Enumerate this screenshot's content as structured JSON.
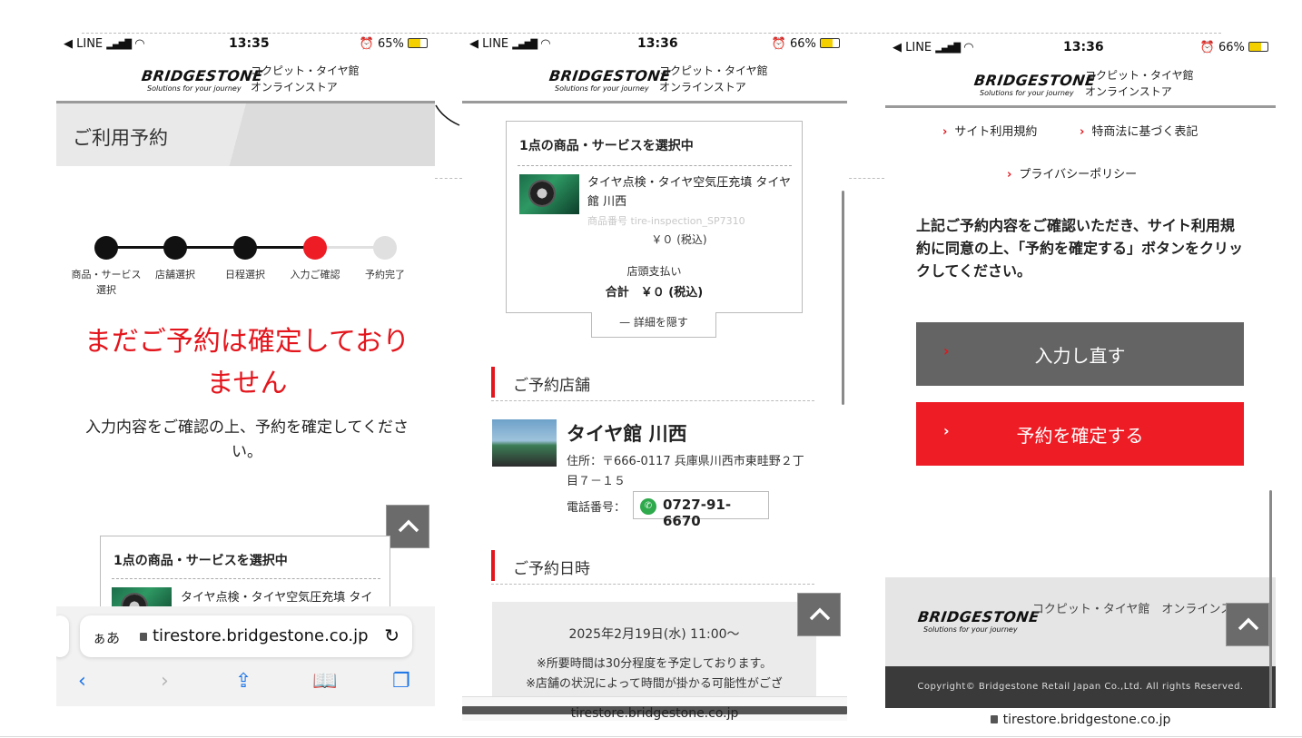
{
  "status_bars": [
    {
      "carrier": "◀ LINE",
      "time": "13:35",
      "battery": "65%"
    },
    {
      "carrier": "◀ LINE",
      "time": "13:36",
      "battery": "66%"
    },
    {
      "carrier": "◀ LINE",
      "time": "13:36",
      "battery": "66%"
    }
  ],
  "header": {
    "brand": "BRIDGESTONE",
    "tagline": "Solutions for your journey",
    "store_line1": "コクピット・タイヤ館",
    "store_line2": "オンラインストア"
  },
  "screen1": {
    "page_title": "ご利用予約",
    "steps": [
      {
        "label": "商品・サービス選択",
        "state": "done"
      },
      {
        "label": "店舗選択",
        "state": "done"
      },
      {
        "label": "日程選択",
        "state": "done"
      },
      {
        "label": "入力ご確認",
        "state": "current"
      },
      {
        "label": "予約完了",
        "state": "todo"
      }
    ],
    "warning": "まだご予約は確定しておりません",
    "instruction": "入力内容をご確認の上、予約を確定してください。",
    "cart_title": "1点の商品・サービスを選択中",
    "cart_item_preview": "タイヤ点検・タイヤ空気圧充填 タイ",
    "address_bar": {
      "aa": "ぁあ",
      "url": "tirestore.bridgestone.co.jp"
    }
  },
  "screen2": {
    "cart_title": "1点の商品・サービスを選択中",
    "product_name": "タイヤ点検・タイヤ空気圧充填 タイヤ館 川西",
    "product_code": "商品番号 tire-inspection_SP7310",
    "price": "￥０ (税込)",
    "payment": "店頭支払い",
    "total": "合計　￥０ (税込)",
    "hide_details": "— 詳細を隠す",
    "store_section": "ご予約店舗",
    "store_name": "タイヤ館 川西",
    "store_address": "住所：〒666-0117 兵庫県川西市東畦野２丁目７－１５",
    "phone_label": "電話番号：",
    "phone_number": "0727-91-6670",
    "date_section": "ご予約日時",
    "datetime": "2025年2月19日(水) 11:00〜",
    "note1": "※所要時間は30分程度を予定しております。",
    "note2": "※店舗の状況によって時間が掛かる可能性がござ",
    "url": "tirestore.bridgestone.co.jp"
  },
  "screen3": {
    "link_terms": "サイト利用規約",
    "link_law": "特商法に基づく表記",
    "link_privacy": "プライバシーポリシー",
    "confirm_text": "上記ご予約内容をご確認いただき、サイト利用規約に同意の上、「予約を確定する」ボタンをクリックしてください。",
    "btn_reenter": "入力し直す",
    "btn_confirm": "予約を確定する",
    "footer_text": "コクピット・タイヤ館　オンラインストア",
    "copyright": "Copyright© Bridgestone Retail Japan Co.,Ltd. All rights Reserved.",
    "url": "tirestore.bridgestone.co.jp"
  },
  "colors": {
    "accent_red": "#ee1c25",
    "button_grey": "#646464",
    "done_step": "#111111",
    "todo_step": "#e0e0e0"
  },
  "icons": [
    "signal-icon",
    "wifi-icon",
    "alarm-icon",
    "battery-icon",
    "lock-icon",
    "reload-icon",
    "back-icon",
    "forward-icon",
    "share-icon",
    "bookmarks-icon",
    "tabs-icon",
    "chevron-up-icon",
    "phone-icon",
    "chevron-right-icon"
  ]
}
